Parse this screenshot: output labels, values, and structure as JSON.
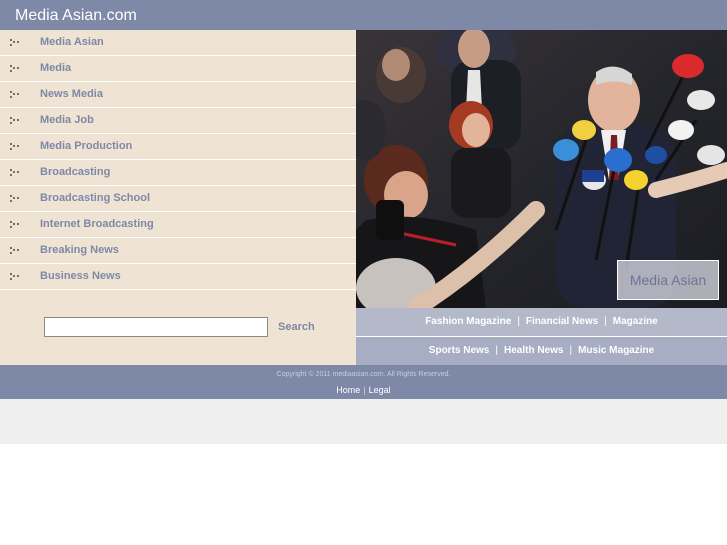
{
  "header": {
    "title": "Media Asian.com"
  },
  "nav": {
    "items": [
      {
        "label": "Media Asian"
      },
      {
        "label": "Media"
      },
      {
        "label": "News Media"
      },
      {
        "label": "Media Job"
      },
      {
        "label": "Media Production"
      },
      {
        "label": "Broadcasting"
      },
      {
        "label": "Broadcasting School"
      },
      {
        "label": "Internet Broadcasting"
      },
      {
        "label": "Breaking News"
      },
      {
        "label": "Business News"
      }
    ],
    "icon": "bullet-dots-icon"
  },
  "search": {
    "value": "",
    "button_label": "Search"
  },
  "photo": {
    "caption": "Media Asian",
    "subject": "press-conference-microphones"
  },
  "links_row_1": [
    "Fashion Magazine",
    "Financial News",
    "Magazine"
  ],
  "links_row_2": [
    "Sports News",
    "Health News",
    "Music Magazine"
  ],
  "footer": {
    "copyright": "Copyright © 2011 mediaasian.com. All Rights Reserved.",
    "links": [
      "Home",
      "Legal"
    ]
  },
  "colors": {
    "header_bg": "#7e88a7",
    "panel_bg": "#efe3d3",
    "link_text": "#7e88a7",
    "links_bar": "#b4b9ca"
  }
}
